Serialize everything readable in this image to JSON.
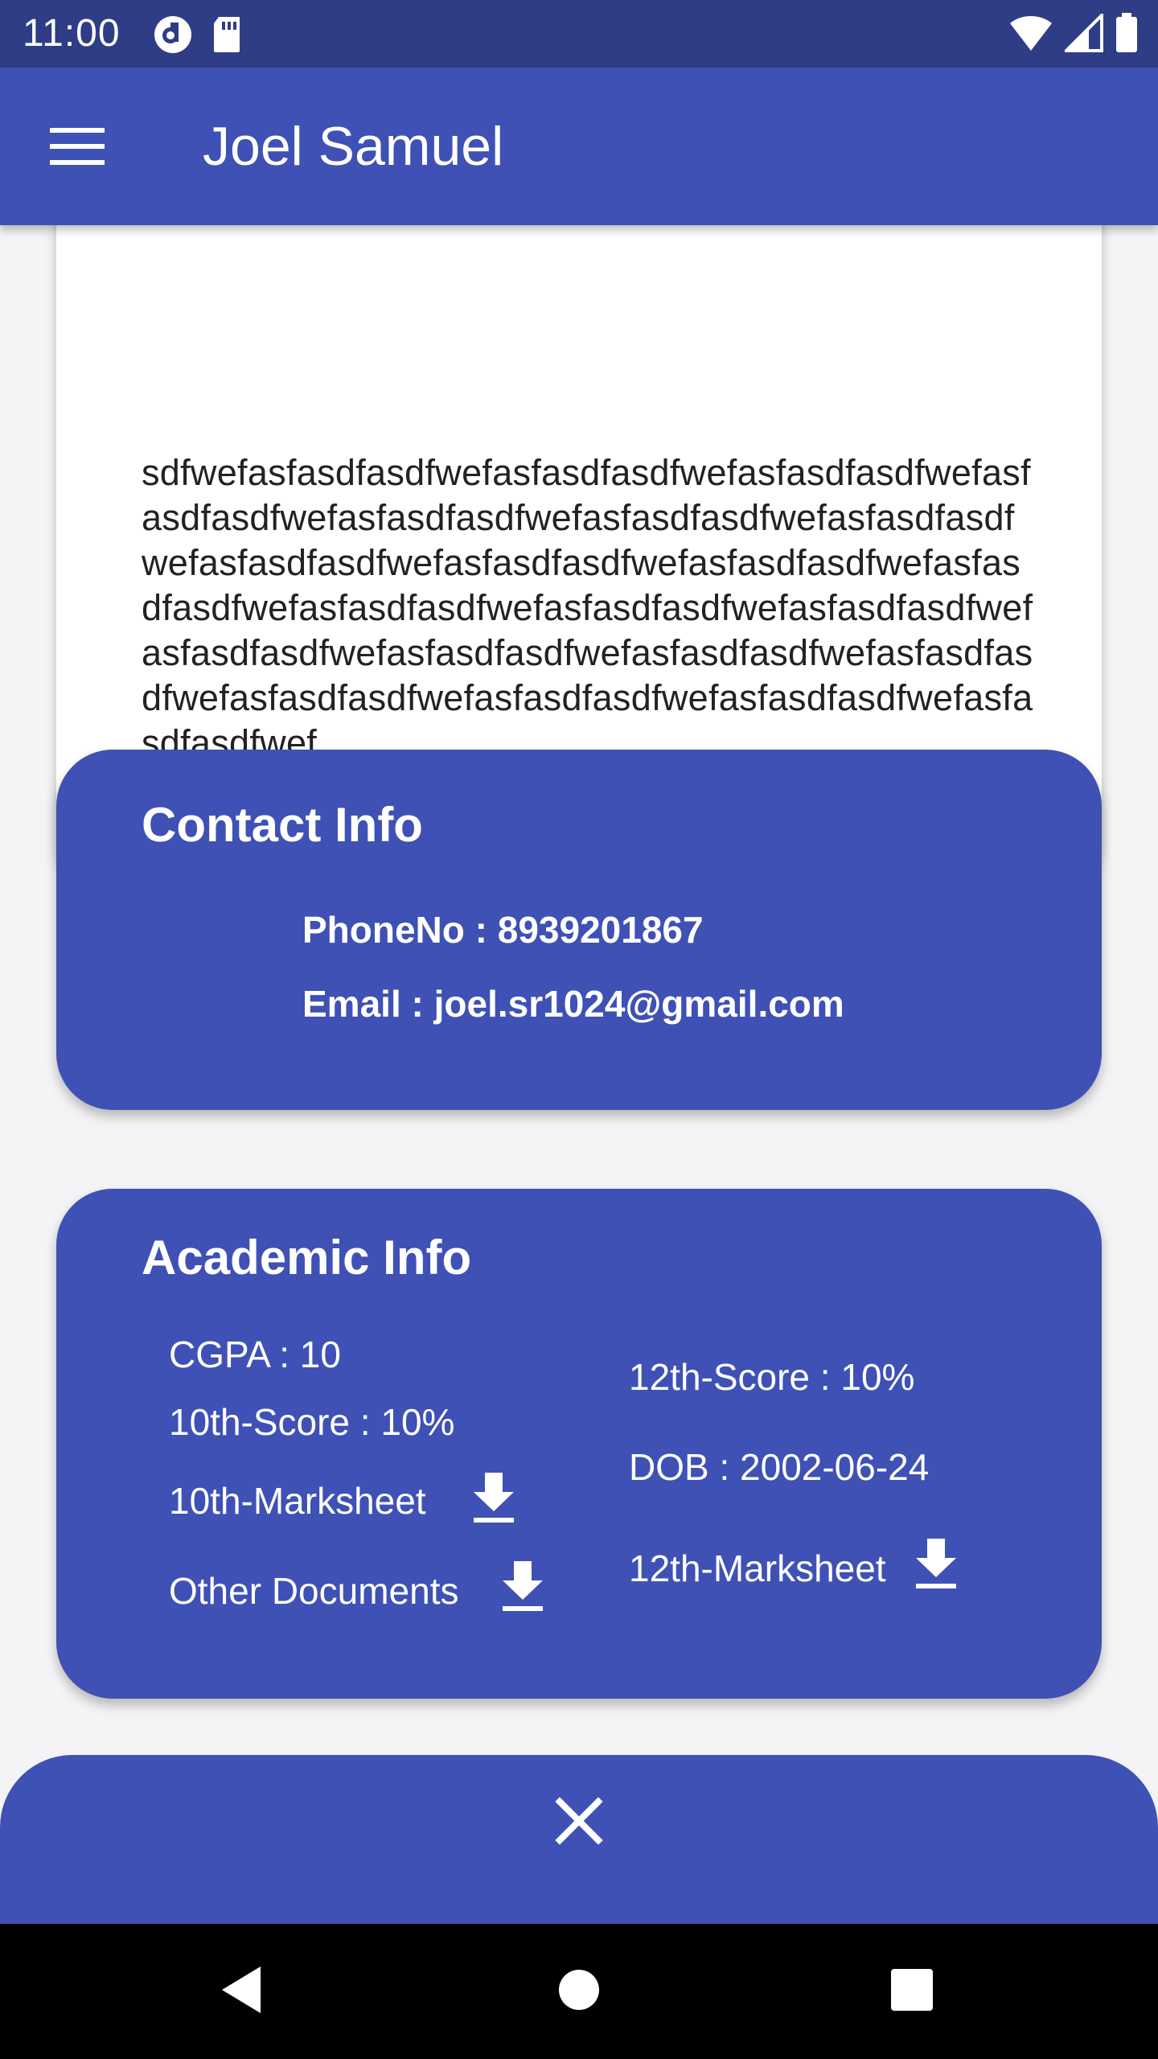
{
  "status_bar": {
    "time": "11:00",
    "left_icons": [
      "pocket-casts-icon",
      "sd-card-icon"
    ],
    "right_icons": [
      "wifi-icon",
      "signal-icon",
      "battery-icon"
    ]
  },
  "app_bar": {
    "title": "Joel Samuel",
    "menu_icon": "hamburger-menu-icon"
  },
  "about": {
    "text": "sdfwefasfasdfasdfwefasfasdfasdfwefasfasdfasdfwefasfasdfasdfwefasfasdfasdfwefasfasdfasdfwefasfasdfasdfwefasfasdfasdfwefasfasdfasdfwefasfasdfasdfwefasfasdfasdfwefasfasdfasdfwefasfasdfasdfwefasfasdfasdfwefasfasdfasdfwefasfasdfasdfwefasfasdfasdfwefasfasdfasdfwefasfasdfasdfwefasfasdfasdfwefasfasdfasdfwefasfasdfasdfwef"
  },
  "contact": {
    "title": "Contact Info",
    "phone": "PhoneNo : 8939201867",
    "email": "Email : joel.sr1024@gmail.com"
  },
  "academic": {
    "title": "Academic Info",
    "cgpa": "CGPA : 10",
    "score_10th": "10th-Score : 10%",
    "marksheet_10th": "10th-Marksheet",
    "other_documents": "Other Documents",
    "score_12th": "12th-Score : 10%",
    "dob": "DOB : 2002-06-24",
    "marksheet_12th": "12th-Marksheet",
    "download_icon": "download-icon"
  },
  "bottom_sheet": {
    "close_icon": "close-icon"
  },
  "nav_bar": {
    "buttons": [
      "back-icon",
      "home-icon",
      "recents-icon"
    ]
  },
  "colors": {
    "primary": "#3f51b5",
    "status_bar": "#2f3c86",
    "background": "#f4f4f6",
    "card_white": "#ffffff",
    "text_dark": "#222222"
  }
}
